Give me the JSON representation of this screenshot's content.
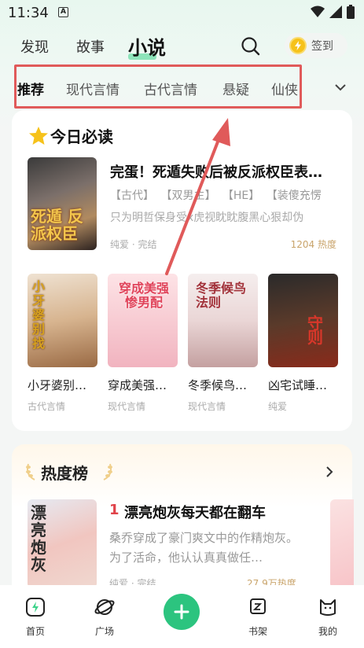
{
  "status_bar": {
    "time": "11:34",
    "notification_icon": "A"
  },
  "header": {
    "tabs": [
      {
        "label": "发现"
      },
      {
        "label": "故事"
      },
      {
        "label": "小说"
      }
    ],
    "active_tab": "小说",
    "signin_label": "签到"
  },
  "categories": {
    "items": [
      {
        "label": "推荐"
      },
      {
        "label": "现代言情"
      },
      {
        "label": "古代言情"
      },
      {
        "label": "悬疑"
      },
      {
        "label": "仙侠"
      }
    ],
    "active": "推荐"
  },
  "daily": {
    "title": "今日必读",
    "featured": {
      "title": "完蛋！死遁失败后被反派权臣表…",
      "tags": [
        "【古代】",
        "【双男主】",
        "【HE】",
        "【装傻充愣"
      ],
      "desc": "只为明哲保身受x虎视眈眈腹黑心狠却伪",
      "meta": "纯爱 · 完结",
      "heat": "1204 热度",
      "cover_text": "死遁 反派权臣"
    },
    "books": [
      {
        "title": "小牙婆别…",
        "tag": "古代言情",
        "cover_text": "小牙婆别找"
      },
      {
        "title": "穿成美强…",
        "tag": "现代言情",
        "cover_text": "穿成美强惨男配"
      },
      {
        "title": "冬季候鸟…",
        "tag": "现代言情",
        "cover_text": "冬季候鸟法则"
      },
      {
        "title": "凶宅试睡…",
        "tag": "纯爱",
        "cover_text": "守则"
      }
    ]
  },
  "hot": {
    "title": "热度榜",
    "item": {
      "rank": "1",
      "title": "漂亮炮灰每天都在翻车",
      "desc": "桑乔穿成了豪门爽文中的作精炮灰。为了活命，他认认真真做任…",
      "meta": "纯爱 · 完结",
      "heat": "27.9万热度",
      "cover_text": "漂亮炮灰"
    }
  },
  "bottom_nav": {
    "items": [
      {
        "label": "首页"
      },
      {
        "label": "广场"
      },
      {
        "label": "书架"
      },
      {
        "label": "我的"
      }
    ]
  },
  "colors": {
    "accent": "#2cc47f",
    "annotation": "#e05a5a",
    "rank": "#e0434a",
    "heat": "#c9a46b"
  }
}
